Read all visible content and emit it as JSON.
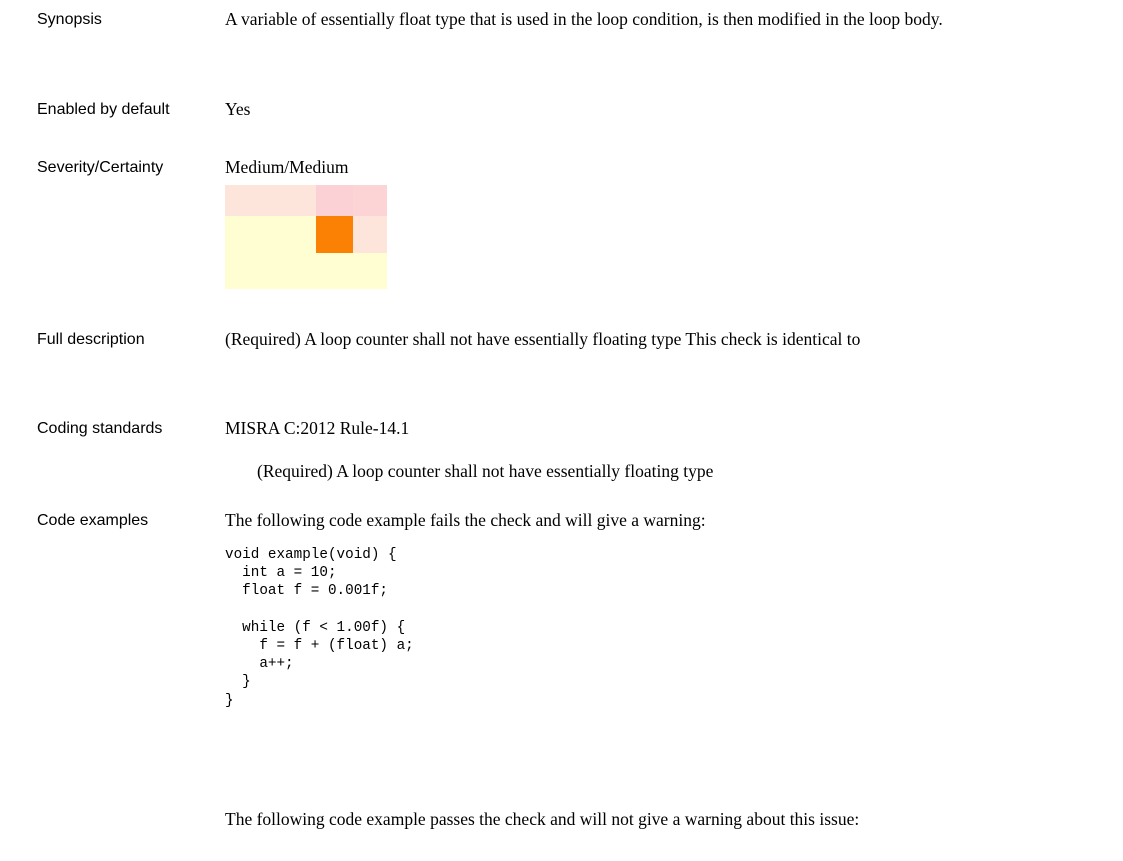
{
  "synopsis": {
    "label": "Synopsis",
    "text": "A variable of essentially float type that is used in the loop condition, is then modified in the loop body."
  },
  "enabled": {
    "label": "Enabled by default",
    "value": "Yes"
  },
  "severity": {
    "label": "Severity/Certainty",
    "value": "Medium/Medium",
    "matrix_colors": [
      [
        "#fde5dc",
        "#fcd1d6",
        "#fcd4d6"
      ],
      [
        "#fffed2",
        "#fb8105",
        "#fde5dc"
      ],
      [
        "#fffed2",
        "#fffed2",
        "#fffed2"
      ]
    ]
  },
  "full_description": {
    "label": "Full description",
    "text": "(Required) A loop counter shall not have essentially floating type This check is identical to"
  },
  "coding_standards": {
    "label": "Coding standards",
    "standard": "MISRA C:2012 Rule-14.1",
    "rule_text": "(Required) A loop counter shall not have essentially floating type"
  },
  "code_examples": {
    "label": "Code examples",
    "fail_intro": "The following code example fails the check and will give a warning:",
    "fail_code": "void example(void) {\n  int a = 10;\n  float f = 0.001f;\n\n  while (f < 1.00f) {\n    f = f + (float) a;\n    a++;\n  }\n}",
    "pass_intro": "The following code example passes the check and will not give a warning about this issue:"
  }
}
